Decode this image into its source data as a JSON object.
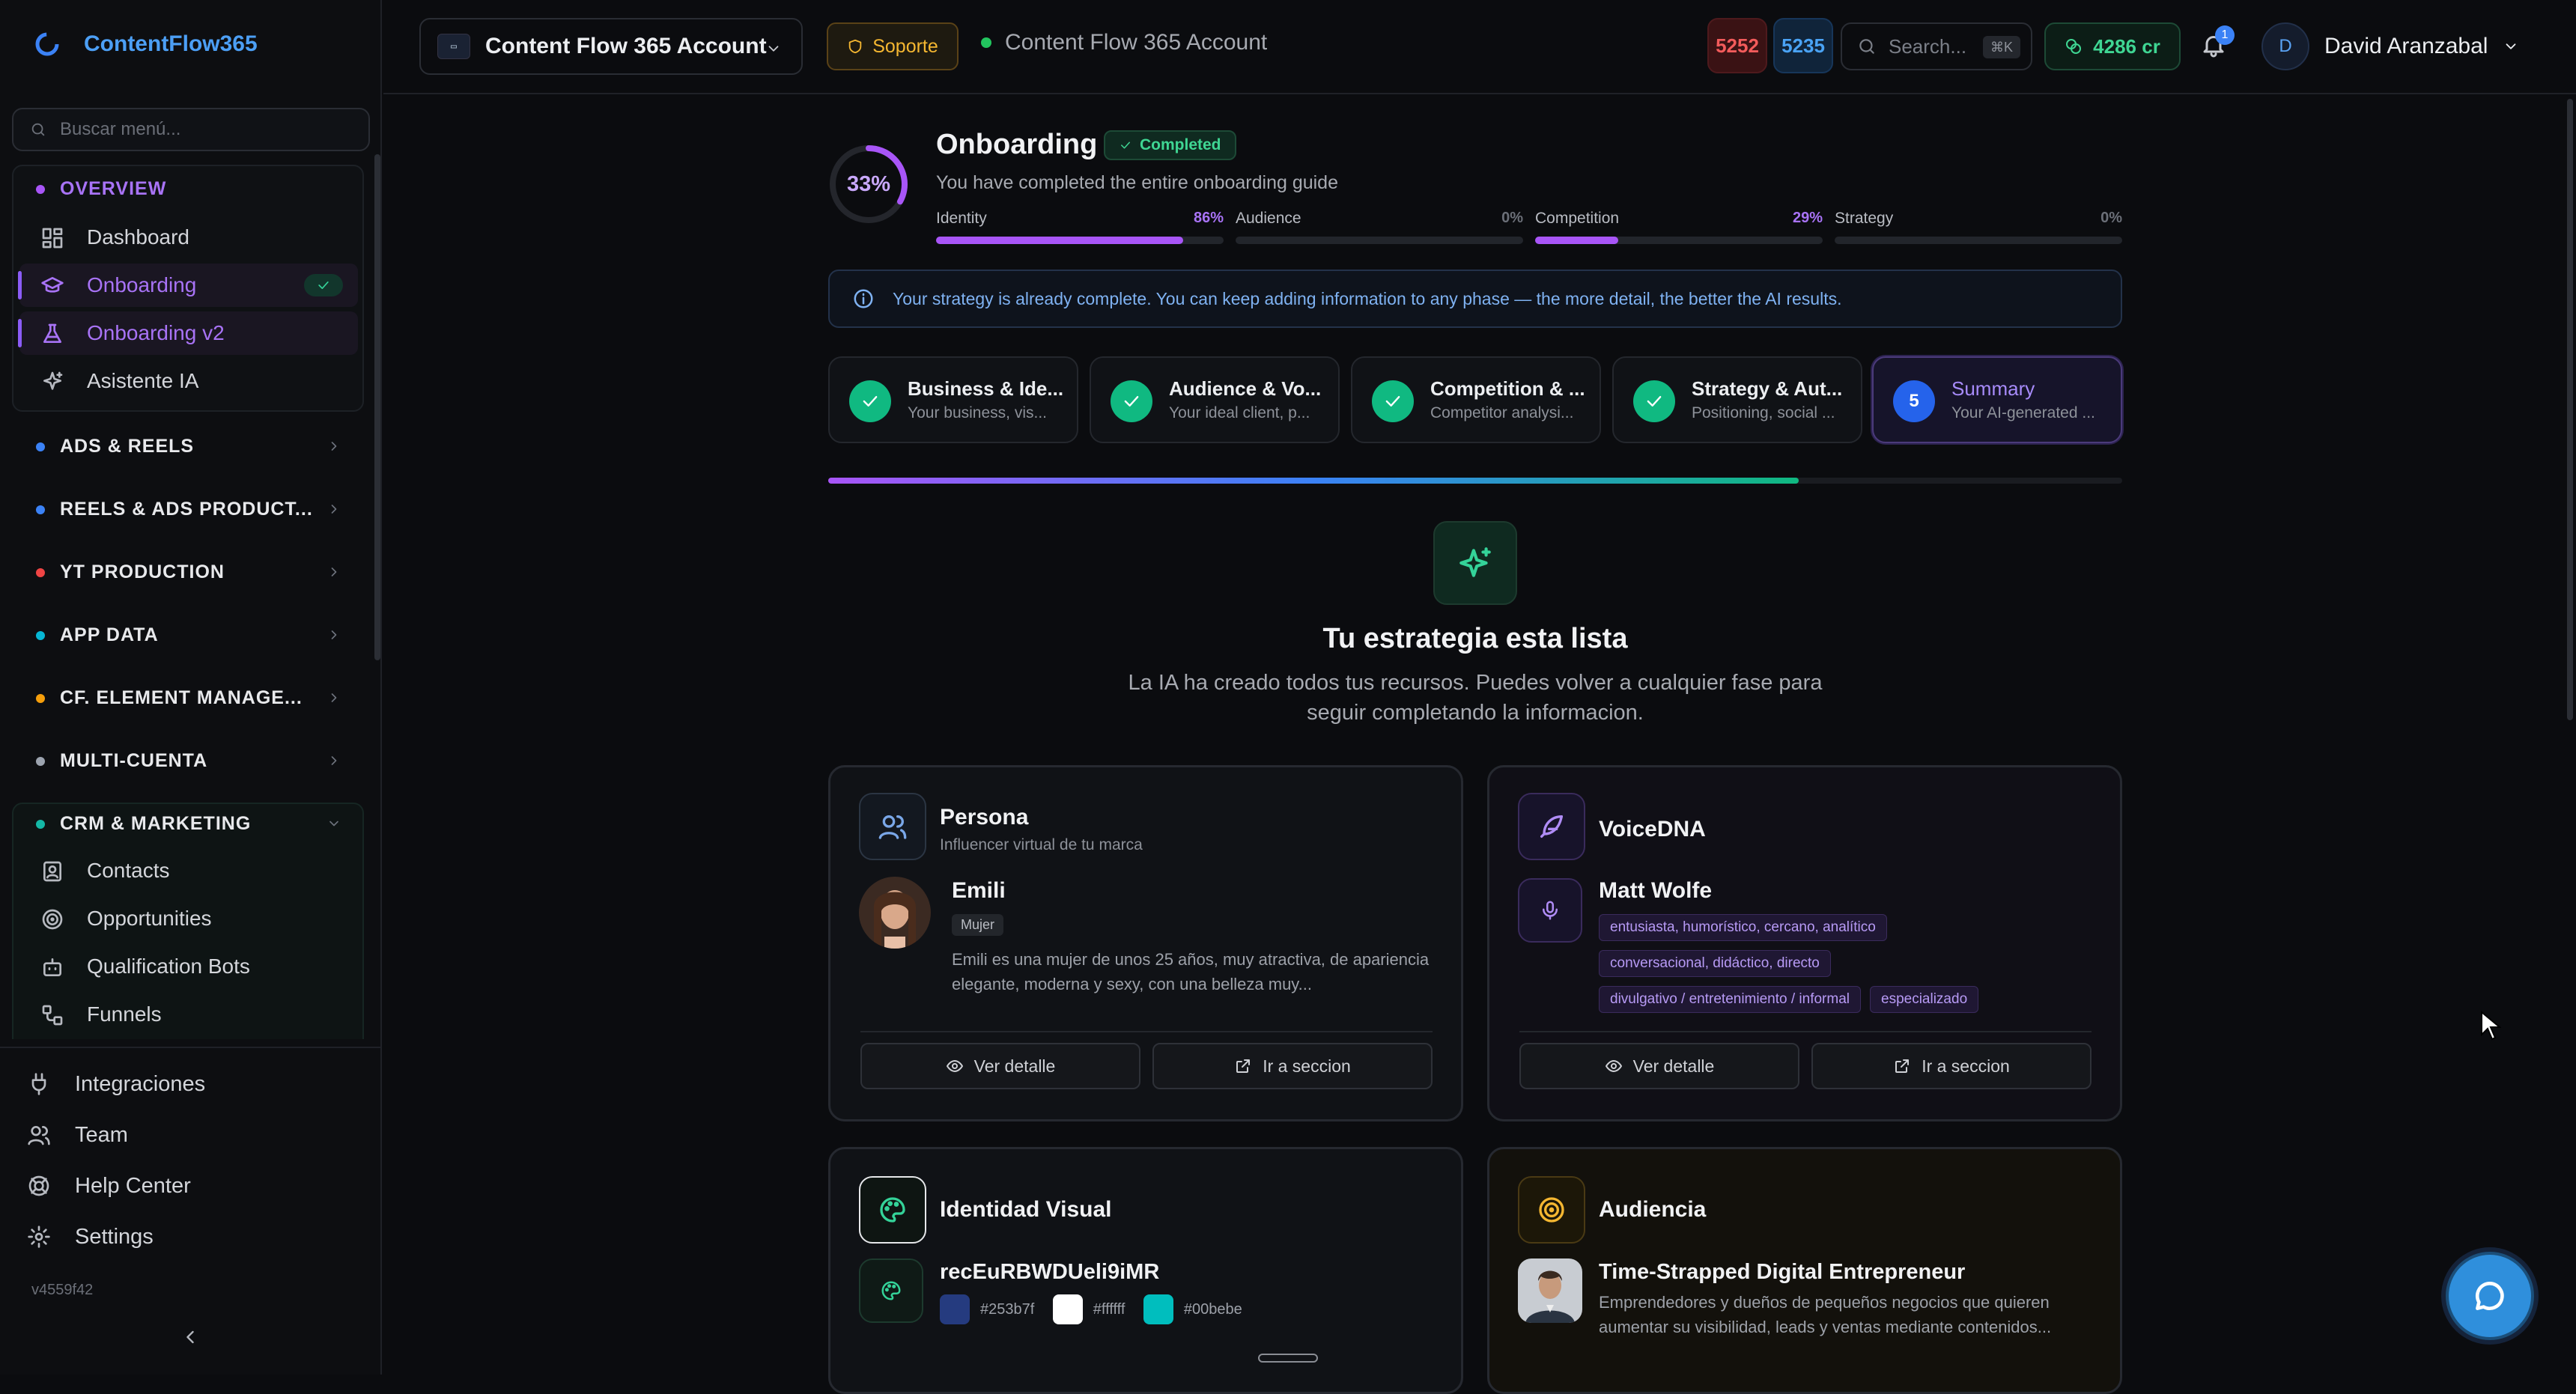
{
  "brand": {
    "name": "ContentFlow365"
  },
  "sidebar": {
    "search_placeholder": "Buscar menú...",
    "overview": {
      "label": "OVERVIEW",
      "items": [
        {
          "label": "Dashboard"
        },
        {
          "label": "Onboarding"
        },
        {
          "label": "Onboarding v2"
        },
        {
          "label": "Asistente IA"
        }
      ]
    },
    "sections": [
      {
        "label": "ADS & REELS",
        "color": "#3b82f6"
      },
      {
        "label": "REELS & ADS PRODUCT...",
        "color": "#3b82f6"
      },
      {
        "label": "YT PRODUCTION",
        "color": "#ef4444"
      },
      {
        "label": "APP DATA",
        "color": "#06b6d4"
      },
      {
        "label": "CF. ELEMENT MANAGE...",
        "color": "#f59e0b"
      },
      {
        "label": "MULTI-CUENTA",
        "color": "#9ca3af"
      }
    ],
    "crm": {
      "label": "CRM & MARKETING",
      "color": "#14b8a6",
      "items": [
        {
          "label": "Contacts"
        },
        {
          "label": "Opportunities"
        },
        {
          "label": "Qualification Bots"
        },
        {
          "label": "Funnels"
        }
      ]
    },
    "bottom": [
      {
        "label": "Integraciones"
      },
      {
        "label": "Team"
      },
      {
        "label": "Help Center"
      },
      {
        "label": "Settings"
      }
    ],
    "version": "v4559f42"
  },
  "topbar": {
    "account": "Content Flow 365 Account",
    "support": "Soporte",
    "status_account": "Content Flow 365 Account",
    "count_red": "5252",
    "count_blue": "5235",
    "search_placeholder": "Search...",
    "search_kbd": "⌘K",
    "credits": "4286 cr",
    "notifications": "1",
    "user_initial": "D",
    "user_name": "David Aranzabal"
  },
  "onboarding": {
    "percent": "33%",
    "percent_value": 33,
    "title": "Onboarding",
    "badge": "Completed",
    "subtitle": "You have completed the entire onboarding guide",
    "progress": [
      {
        "name": "Identity",
        "pct": "86%",
        "value": 86,
        "color": "#a855f7"
      },
      {
        "name": "Audience",
        "pct": "0%",
        "value": 0,
        "color": "#6b6f78"
      },
      {
        "name": "Competition",
        "pct": "29%",
        "value": 29,
        "color": "#a855f7"
      },
      {
        "name": "Strategy",
        "pct": "0%",
        "value": 0,
        "color": "#6b6f78"
      }
    ],
    "info": "Your strategy is already complete. You can keep adding information to any phase — the more detail, the better the AI results.",
    "steps": [
      {
        "title": "Business & Ide...",
        "sub": "Your business, vis..."
      },
      {
        "title": "Audience & Vo...",
        "sub": "Your ideal client, p..."
      },
      {
        "title": "Competition & ...",
        "sub": "Competitor analysi..."
      },
      {
        "title": "Strategy & Aut...",
        "sub": "Positioning, social ..."
      },
      {
        "num": "5",
        "title": "Summary",
        "sub": "Your AI-generated ..."
      }
    ],
    "overall_progress": 75,
    "ready_title": "Tu estrategia esta lista",
    "ready_sub": "La IA ha creado todos tus recursos. Puedes volver a cualquier fase para seguir completando la informacion."
  },
  "cards": {
    "persona": {
      "title": "Persona",
      "subtitle": "Influencer virtual de tu marca",
      "name": "Emili",
      "gender": "Mujer",
      "desc": "Emili es una mujer de unos 25 años, muy atractiva, de apariencia elegante, moderna y sexy, con una belleza muy...",
      "btn_detail": "Ver detalle",
      "btn_go": "Ir a seccion"
    },
    "voice": {
      "title": "VoiceDNA",
      "name": "Matt Wolfe",
      "tags": [
        "entusiasta, humorístico, cercano, analítico",
        "conversacional, didáctico, directo",
        "divulgativo / entretenimiento / informal",
        "especializado"
      ],
      "btn_detail": "Ver detalle",
      "btn_go": "Ir a seccion"
    },
    "visual": {
      "title": "Identidad Visual",
      "id": "recEuRBWDUeli9iMR",
      "colors": [
        {
          "hex": "#253b7f"
        },
        {
          "hex": "#ffffff"
        },
        {
          "hex": "#00bebe"
        }
      ]
    },
    "audience": {
      "title": "Audiencia",
      "name": "Time-Strapped Digital Entrepreneur",
      "desc": "Emprendedores y dueños de pequeños negocios que quieren aumentar su visibilidad, leads y ventas mediante contenidos..."
    }
  }
}
